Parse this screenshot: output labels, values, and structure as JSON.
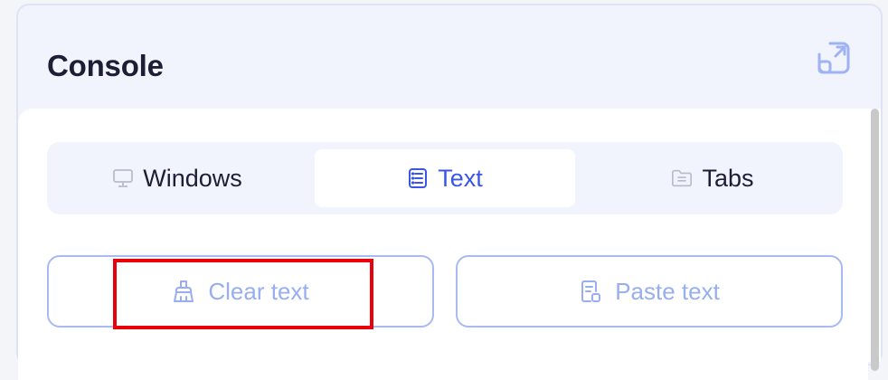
{
  "panel": {
    "title": "Console",
    "popout_icon": "external-open-icon"
  },
  "tabs": [
    {
      "label": "Windows",
      "icon": "monitor-icon",
      "active": false
    },
    {
      "label": "Text",
      "icon": "document-lines-icon",
      "active": true
    },
    {
      "label": "Tabs",
      "icon": "folder-icon",
      "active": false
    }
  ],
  "actions": {
    "clear_label": "Clear text",
    "clear_icon": "broom-icon",
    "paste_label": "Paste text",
    "paste_icon": "paste-document-icon"
  },
  "colors": {
    "accent": "#3a56e8",
    "button_text": "#98aef0",
    "button_border": "#a9b9f2",
    "highlight": "#e8000b",
    "panel_bg": "#f1f3fd"
  }
}
